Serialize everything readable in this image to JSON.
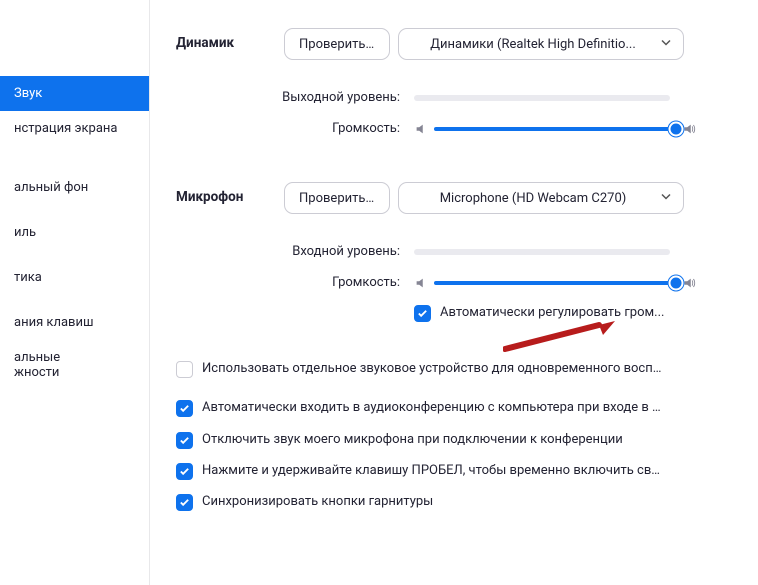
{
  "sidebar": {
    "items": [
      {
        "label": "Звук",
        "active": true
      },
      {
        "label": "нстрация экрана"
      },
      {
        "label": "альный фон"
      },
      {
        "label": "иль"
      },
      {
        "label": "тика"
      },
      {
        "label": "ания клавиш"
      },
      {
        "label": "альные\nжности"
      }
    ]
  },
  "speaker": {
    "section_label": "Динамик",
    "test_button": "Проверить ...",
    "device": "Динамики (Realtek High Definitio...",
    "output_level_label": "Выходной уровень:",
    "volume_label": "Громкость:"
  },
  "mic": {
    "section_label": "Микрофон",
    "test_button": "Проверить ...",
    "device": "Microphone (HD Webcam C270)",
    "input_level_label": "Входной уровень:",
    "volume_label": "Громкость:",
    "auto_adjust": "Автоматически регулировать гром..."
  },
  "options": {
    "separate_device": "Использовать отдельное звуковое устройство для одновременного воспро...",
    "auto_join": "Автоматически входить в аудиоконференцию с компьютера при входе в кон...",
    "mute_on_join": "Отключить звук моего микрофона при подключении к конференции",
    "push_to_talk": "Нажмите и удерживайте клавишу ПРОБЕЛ, чтобы временно включить свой з...",
    "sync_headset": "Синхронизировать кнопки гарнитуры"
  },
  "checks": {
    "auto_adjust": true,
    "separate_device": false,
    "auto_join": true,
    "mute_on_join": true,
    "push_to_talk": true,
    "sync_headset": true
  }
}
